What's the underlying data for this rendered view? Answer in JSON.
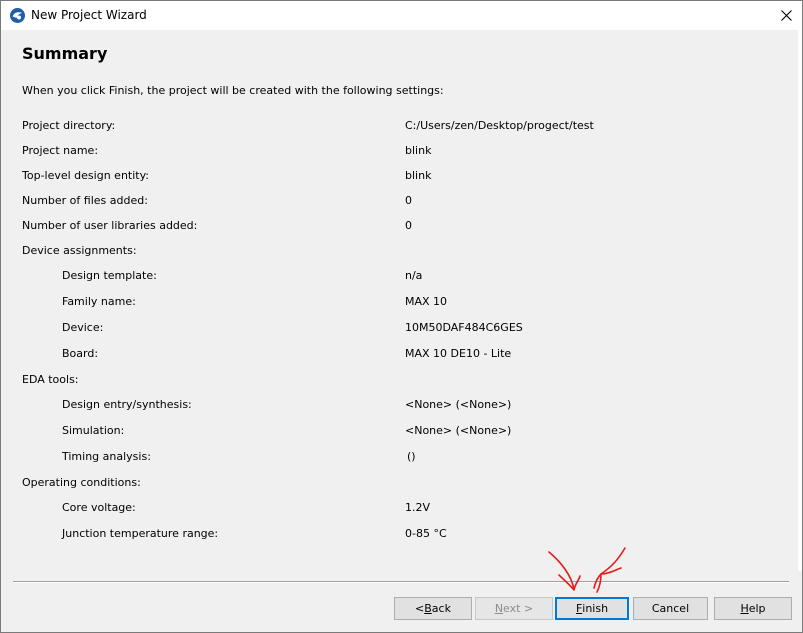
{
  "window": {
    "title": "New Project Wizard"
  },
  "header": {
    "title": "Summary",
    "intro": "When you click Finish, the project will be created with the following settings:"
  },
  "settings": [
    {
      "label": "Project directory:",
      "value": "C:/Users/zen/Desktop/progect/test"
    },
    {
      "label": "Project name:",
      "value": "blink"
    },
    {
      "label": "Top-level design entity:",
      "value": "blink"
    },
    {
      "label": "Number of files added:",
      "value": "0"
    },
    {
      "label": "Number of user libraries added:",
      "value": "0"
    },
    {
      "label": "Device assignments:",
      "value": ""
    },
    {
      "label": "Design template:",
      "value": "n/a"
    },
    {
      "label": "Family name:",
      "value": "MAX 10"
    },
    {
      "label": "Device:",
      "value": "10M50DAF484C6GES"
    },
    {
      "label": "Board:",
      "value": "MAX 10 DE10 - Lite"
    },
    {
      "label": "EDA tools:",
      "value": ""
    },
    {
      "label": "Design entry/synthesis:",
      "value": "<None> (<None>)"
    },
    {
      "label": "Simulation:",
      "value": "<None> (<None>)"
    },
    {
      "label": "Timing analysis:",
      "value": "()"
    },
    {
      "label": "Operating conditions:",
      "value": ""
    },
    {
      "label": "Core voltage:",
      "value": "1.2V"
    },
    {
      "label": "Junction temperature range:",
      "value": "0-85 °C"
    }
  ],
  "buttons": {
    "back": {
      "label": "< Back",
      "mnemonic": "B"
    },
    "next": {
      "label": "Next >",
      "mnemonic": "N"
    },
    "finish": {
      "label": "Finish",
      "mnemonic": "F"
    },
    "cancel": {
      "label": "Cancel"
    },
    "help": {
      "label": "Help",
      "mnemonic": "H"
    }
  },
  "colors": {
    "annotation": "#e51b1b",
    "default_button_border": "#0078d7",
    "dialog_background": "#f0f0f0"
  },
  "icons": {
    "app": "quartus-logo-icon",
    "close": "close-icon",
    "annotation": "red-arrow-icon"
  }
}
